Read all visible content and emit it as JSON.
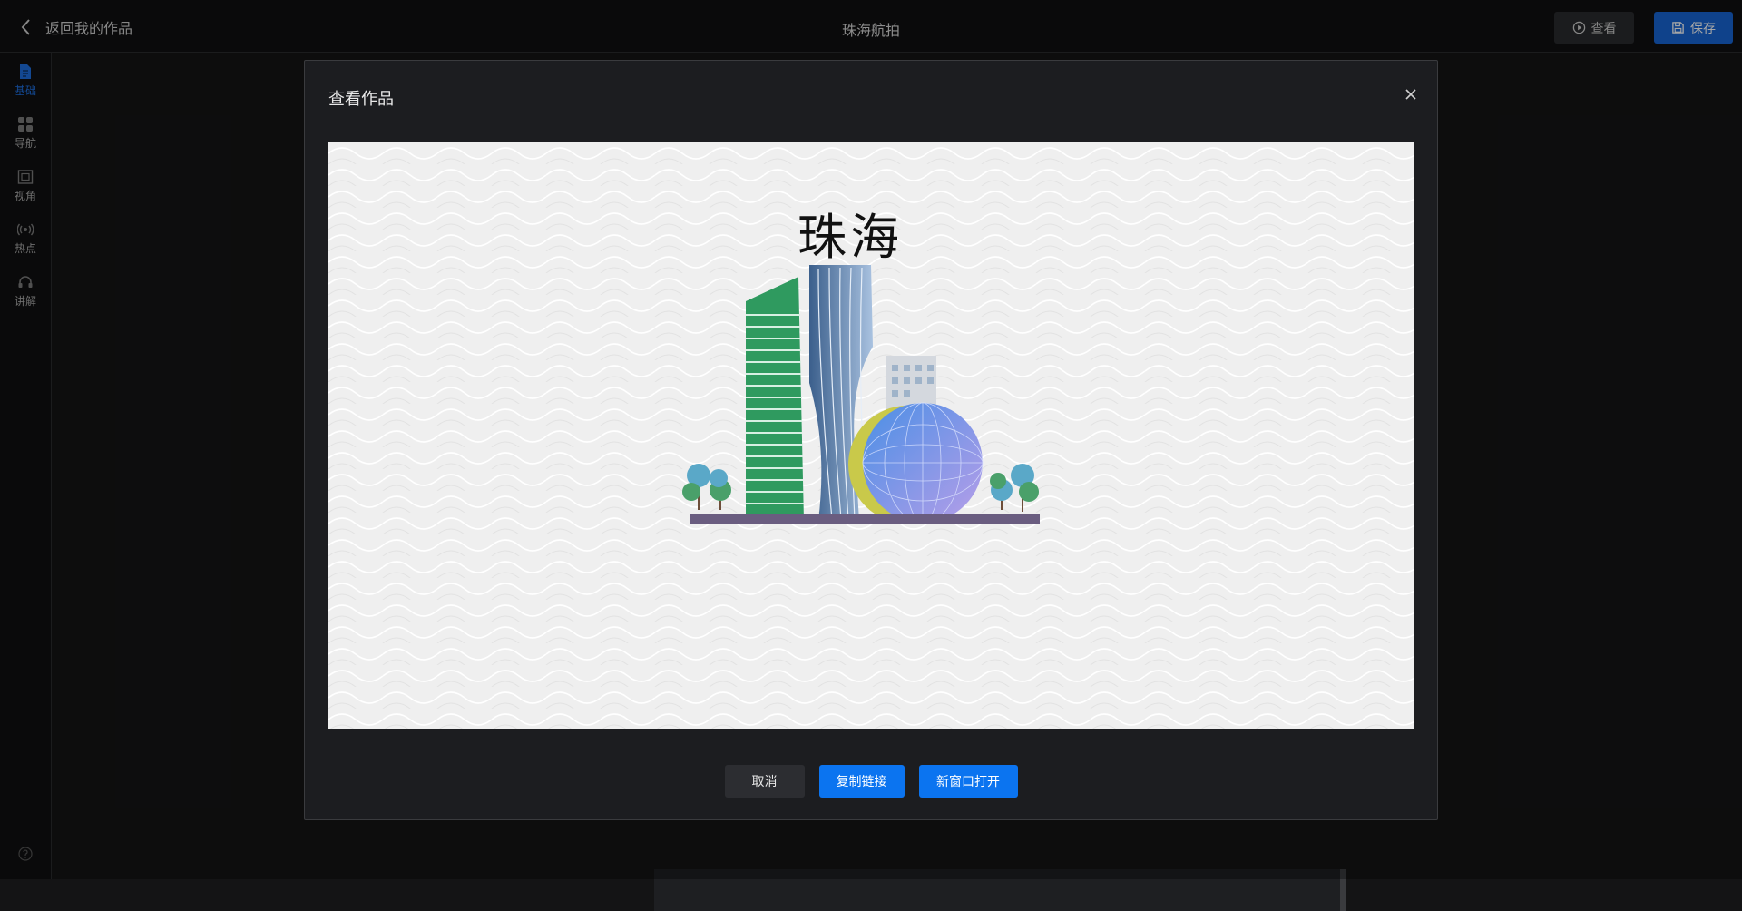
{
  "header": {
    "back_label": "返回我的作品",
    "title": "珠海航拍",
    "view_label": "查看",
    "save_label": "保存"
  },
  "sidebar": {
    "items": [
      {
        "label": "基础",
        "icon": "document-icon",
        "active": true
      },
      {
        "label": "导航",
        "icon": "grid-icon",
        "active": false
      },
      {
        "label": "视角",
        "icon": "image-frame-icon",
        "active": false
      },
      {
        "label": "热点",
        "icon": "signal-icon",
        "active": false
      },
      {
        "label": "讲解",
        "icon": "headset-icon",
        "active": false
      }
    ],
    "help_icon": "help-icon"
  },
  "modal": {
    "title": "查看作品",
    "preview_title": "珠海",
    "buttons": {
      "cancel": "取消",
      "copy_link": "复制链接",
      "open_new_window": "新窗口打开"
    }
  },
  "colors": {
    "accent": "#0b74f0",
    "save_button": "#1766d6",
    "active_nav": "#1e6fe0",
    "background": "#141415"
  }
}
